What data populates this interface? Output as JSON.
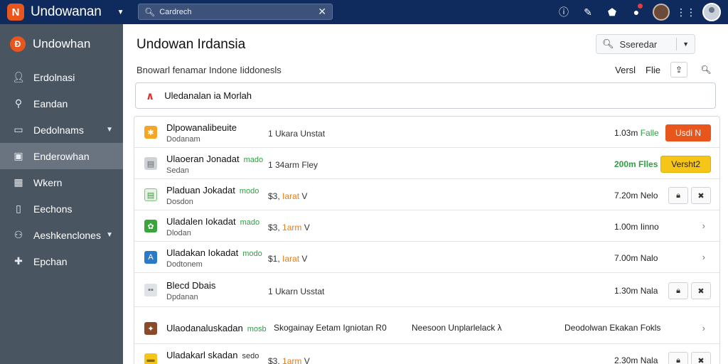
{
  "topbar": {
    "brand": "Undowanan",
    "search_value": "Cardrech",
    "icons": [
      "help-icon",
      "edit-icon",
      "bell-icon",
      "notification-icon",
      "avatar",
      "grid-icon",
      "profile-avatar"
    ]
  },
  "sidebar": {
    "brand": "Undowhan",
    "items": [
      {
        "icon": "user-icon",
        "label": "Erdolnasi"
      },
      {
        "icon": "key-icon",
        "label": "Eandan"
      },
      {
        "icon": "folder-icon",
        "label": "Dedolnams",
        "caret": true
      },
      {
        "icon": "drive-icon",
        "label": "Enderowhan",
        "active": true
      },
      {
        "icon": "grid-icon",
        "label": "Wkern"
      },
      {
        "icon": "doc-icon",
        "label": "Eechons"
      },
      {
        "icon": "network-icon",
        "label": "Aeshkenclones",
        "caret": true
      },
      {
        "icon": "plus-icon",
        "label": "Epchan"
      }
    ]
  },
  "main": {
    "title": "Undowan Irdansia",
    "select_placeholder": "Sseredar",
    "subtitle": "Bnowarl fenamar Indone Iiddonesls",
    "sub_actions": {
      "view": "Versl",
      "file": "Flie"
    },
    "alert": "Uledanalan ia Morlah",
    "rows": [
      {
        "title": "Dlpowanalibeuite",
        "tag": "",
        "sub": "Dodanam",
        "mid_pre": "1 Ukara Unstat",
        "mid_hl": "",
        "mid_post": "",
        "size": "1.03m",
        "size_tag": "Falle",
        "action": "Usdi N",
        "action_type": "red"
      },
      {
        "title": "Ulaoeran Jonadat",
        "tag": "mado",
        "sub": "Sedan",
        "mid_pre": "1 34arm Fley",
        "mid_hl": "",
        "mid_post": "",
        "size": "200m",
        "size_tag": "Flles",
        "action": "Versht2",
        "action_type": "yellow"
      },
      {
        "title": "Pladuan Jokadat",
        "tag": "modo",
        "sub": "Dosdon",
        "mid_pre": "$3, ",
        "mid_hl": "Iarat",
        "mid_post": " V",
        "size": "7.20m",
        "size_tag": "Nelo",
        "action": "",
        "action_type": "icons"
      },
      {
        "title": "Uladalen Iokadat",
        "tag": "mado",
        "sub": "Dlodan",
        "mid_pre": "$3, ",
        "mid_hl": "1arm",
        "mid_post": " V",
        "size": "1.00m",
        "size_tag": "Iinno",
        "action": "",
        "action_type": "chevron"
      },
      {
        "title": "Uladakan Iokadat",
        "tag": "modo",
        "sub": "Dodtonem",
        "mid_pre": "$1, ",
        "mid_hl": "Iarat",
        "mid_post": " V",
        "size": "7.00m",
        "size_tag": "Nalo",
        "action": "",
        "action_type": "chevron"
      },
      {
        "title": "Blecd Dbais",
        "tag": "",
        "sub": "Dpdanan",
        "mid_pre": "1 Ukarn Usstat",
        "mid_hl": "",
        "mid_post": "",
        "size": "1.30m",
        "size_tag": "Nala",
        "action": "",
        "action_type": "icons"
      },
      {
        "title": "Ulaodanaluskadan",
        "tag": "mosb",
        "sub": "",
        "wide": [
          "Skogainay Eetam Igniotan R0",
          "Neesoon Unplarlelack λ",
          "Deodolwan Ekakan Fokls"
        ],
        "action_type": "chevron"
      },
      {
        "title": "Uladakarl skadan",
        "tag": "sedo",
        "sub": "",
        "mid_pre": "$3, ",
        "mid_hl": "1arm",
        "mid_post": " V",
        "size": "2.30m",
        "size_tag": "Nala",
        "action": "",
        "action_type": "icons"
      }
    ]
  },
  "colors": {
    "topbar": "#0f2a5c",
    "sidebar": "#4a5562",
    "accent_red": "#e8561e",
    "accent_yellow": "#f5c518",
    "tag_green": "#2ea043",
    "highlight_orange": "#e57c19"
  }
}
